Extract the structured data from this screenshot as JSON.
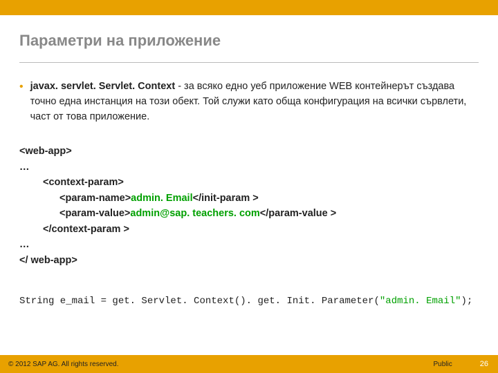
{
  "title": "Параметри на приложение",
  "bullet": {
    "strong": "javax. servlet. Servlet. Context",
    "rest": " - за всяко едно уеб приложение WEB контейнерът създава точно една инстанция на този обект. Той служи като обща конфигурация на всички сървлети, част от това приложение."
  },
  "xml": {
    "l1": "<web-app>",
    "l2": "…",
    "l3": "<context-param>",
    "l4a": "<param-name>",
    "l4b": "admin. Email",
    "l4c": "</init-param >",
    "l5a": "<param-value>",
    "l5b": "admin@sap. teachers. com",
    "l5c": "</param-value >",
    "l6": "</context-param >",
    "l7": "…",
    "l8": "</ web-app>"
  },
  "code": {
    "pre": "String e_mail = get. Servlet. Context(). get. Init. Parameter(",
    "str": "\"admin. Email\"",
    "post": ");"
  },
  "footer": {
    "copyright": "© 2012 SAP AG. All rights reserved.",
    "classification": "Public",
    "page": "26"
  }
}
